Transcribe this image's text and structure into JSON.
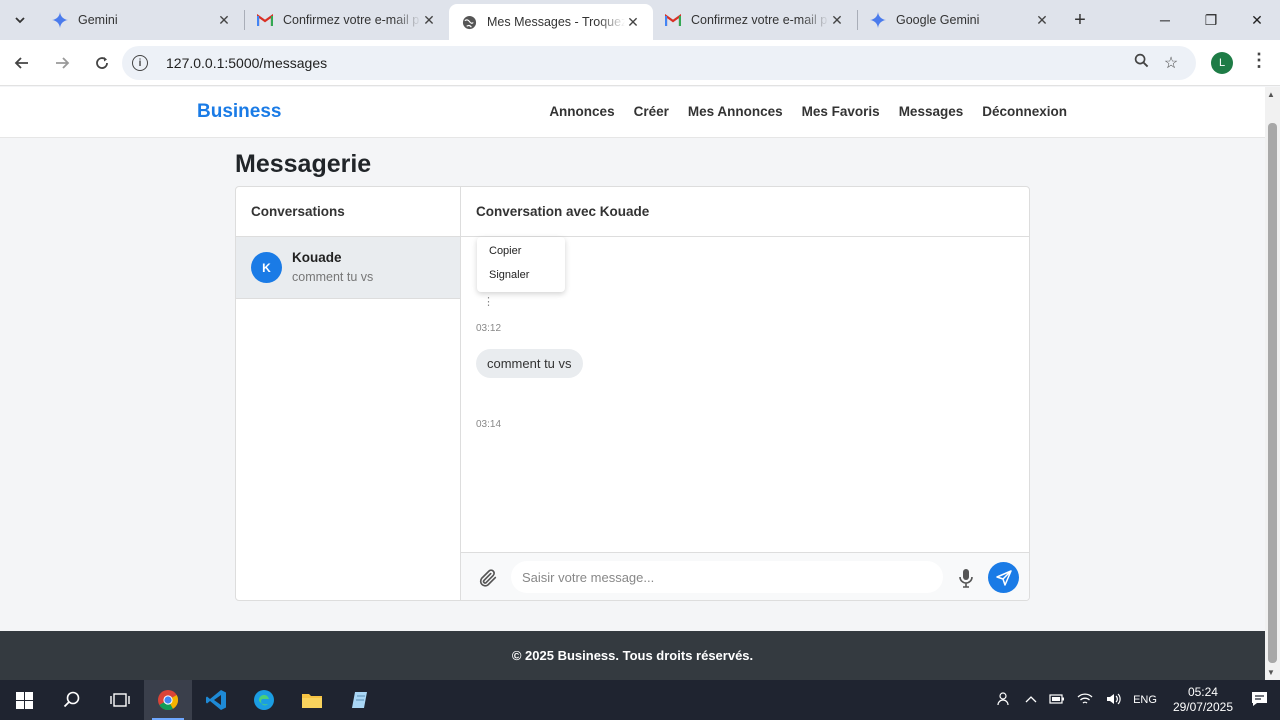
{
  "browser": {
    "tabs": [
      {
        "title": "Gemini",
        "active": false
      },
      {
        "title": "Confirmez votre e-mail p",
        "active": false
      },
      {
        "title": "Mes Messages - Troquez",
        "active": true
      },
      {
        "title": "Confirmez votre e-mail p",
        "active": false
      },
      {
        "title": "Google Gemini",
        "active": false
      }
    ],
    "url": "127.0.0.1:5000/messages",
    "profile_initial": "L"
  },
  "site": {
    "brand": "Business",
    "nav": [
      "Annonces",
      "Créer",
      "Mes Annonces",
      "Mes Favoris",
      "Messages",
      "Déconnexion"
    ]
  },
  "page": {
    "title": "Messagerie",
    "conversations_header": "Conversations",
    "conversations": [
      {
        "initial": "K",
        "name": "Kouade",
        "last_message": "comment tu vs"
      }
    ],
    "chat_header": "Conversation avec Kouade",
    "context_menu": [
      "Copier",
      "Signaler"
    ],
    "more_glyph": "⋮",
    "messages": [
      {
        "time": "03:12"
      },
      {
        "text": "comment tu vs",
        "time": "03:14"
      }
    ],
    "composer_placeholder": "Saisir votre message..."
  },
  "footer": {
    "text": "© 2025 Business. Tous droits réservés."
  },
  "taskbar": {
    "lang": "ENG",
    "time": "05:24",
    "date": "29/07/2025"
  },
  "colors": {
    "accent": "#1a7be6",
    "footer_bg": "#343a40",
    "taskbar_bg": "#1f2430"
  }
}
